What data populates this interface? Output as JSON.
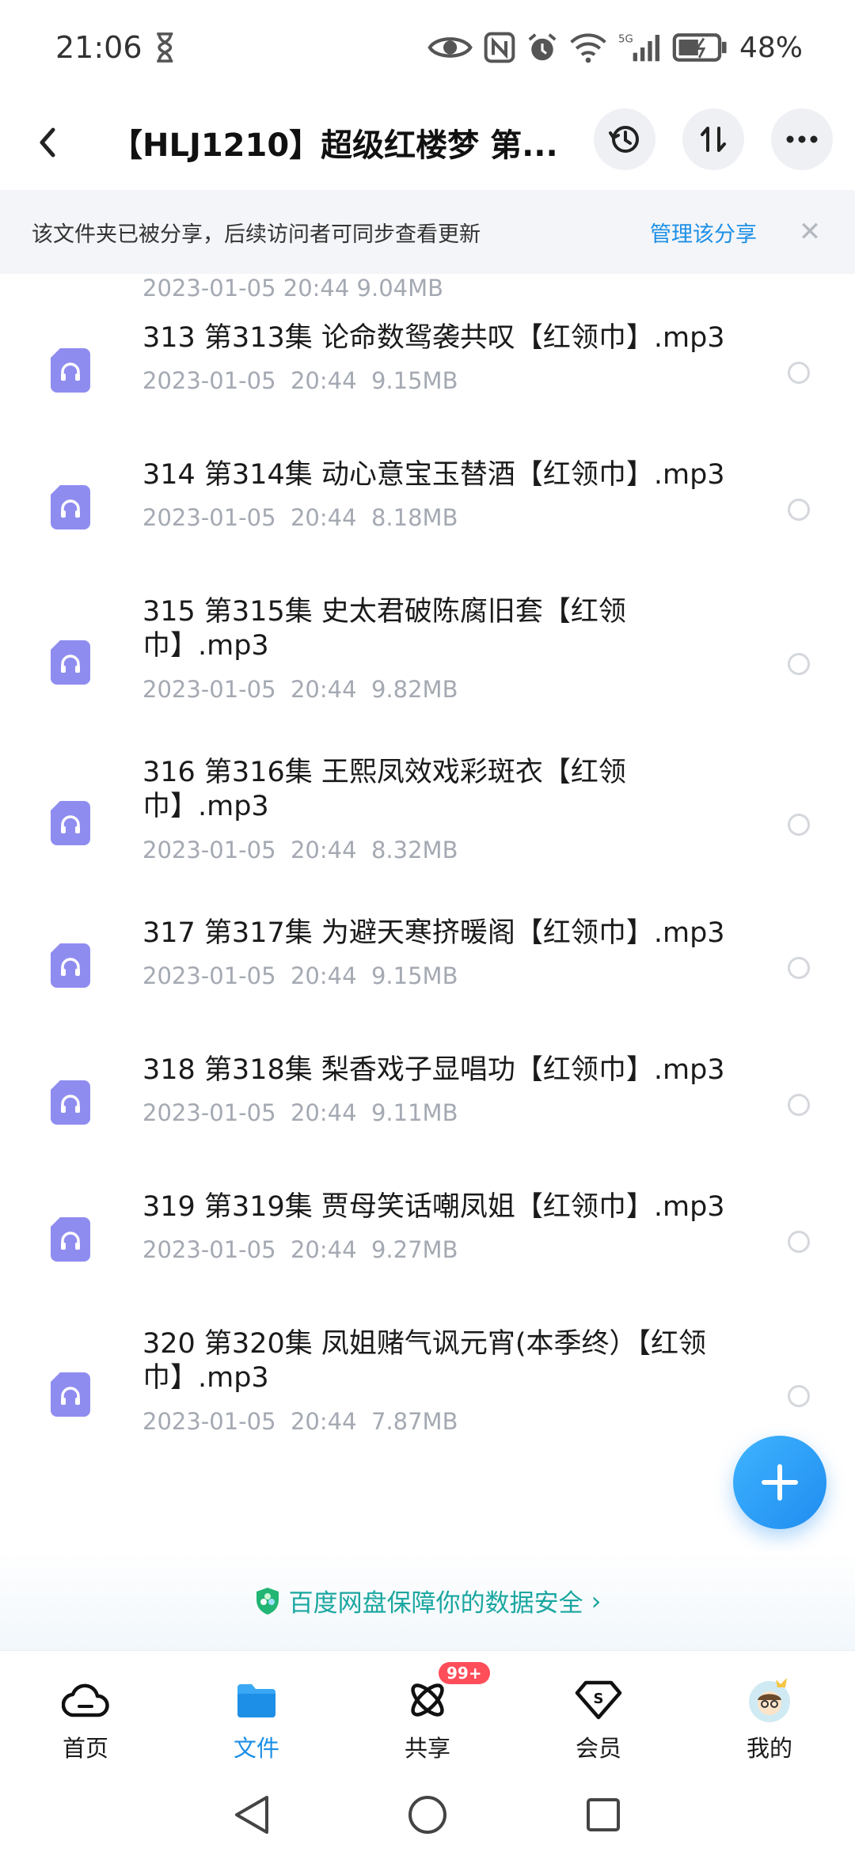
{
  "status_bar": {
    "time": "21:06",
    "battery": "48%",
    "icons": [
      "hourglass-icon",
      "eye-icon",
      "nfc-icon",
      "alarm-icon",
      "wifi-icon",
      "signal-5g-icon",
      "battery-icon"
    ]
  },
  "header": {
    "title": "【HLJ1210】超级红楼梦 第...",
    "icons": [
      "back-icon",
      "history-icon",
      "sort-icon",
      "more-icon"
    ]
  },
  "share_banner": {
    "text": "该文件夹已被分享，后续访问者可同步查看更新",
    "manage_label": "管理该分享",
    "close_label": "✕"
  },
  "partial_row": {
    "meta": "2023-01-05  20:44  9.04MB"
  },
  "files": [
    {
      "name": "313 第313集 论命数鸳袭共叹【红领巾】.mp3",
      "meta": "2023-01-05  20:44  9.15MB"
    },
    {
      "name": "314 第314集 动心意宝玉替酒【红领巾】.mp3",
      "meta": "2023-01-05  20:44  8.18MB"
    },
    {
      "name": "315 第315集 史太君破陈腐旧套【红领巾】.mp3",
      "meta": "2023-01-05  20:44  9.82MB"
    },
    {
      "name": "316 第316集 王熙凤效戏彩斑衣【红领巾】.mp3",
      "meta": "2023-01-05  20:44  8.32MB"
    },
    {
      "name": "317 第317集 为避天寒挤暖阁【红领巾】.mp3",
      "meta": "2023-01-05  20:44  9.15MB"
    },
    {
      "name": "318 第318集 梨香戏子显唱功【红领巾】.mp3",
      "meta": "2023-01-05  20:44  9.11MB"
    },
    {
      "name": "319 第319集 贾母笑话嘲凤姐【红领巾】.mp3",
      "meta": "2023-01-05  20:44  9.27MB"
    },
    {
      "name": "320 第320集 凤姐赌气讽元宵(本季终）【红领巾】.mp3",
      "meta": "2023-01-05  20:44  7.87MB"
    }
  ],
  "security_note": {
    "text": "百度网盘保障你的数据安全",
    "chevron": "›"
  },
  "bottom_nav": [
    {
      "label": "首页",
      "icon": "cloud-home-icon"
    },
    {
      "label": "文件",
      "icon": "folder-icon"
    },
    {
      "label": "共享",
      "icon": "share-orbit-icon",
      "badge": "99+"
    },
    {
      "label": "会员",
      "icon": "vip-diamond-icon"
    },
    {
      "label": "我的",
      "icon": "avatar-icon"
    }
  ],
  "colors": {
    "accent": "#1d8fe6",
    "audio_icon": "#8f8cf0",
    "security_text": "#1aa6a0",
    "badge": "#ff4d5a"
  }
}
